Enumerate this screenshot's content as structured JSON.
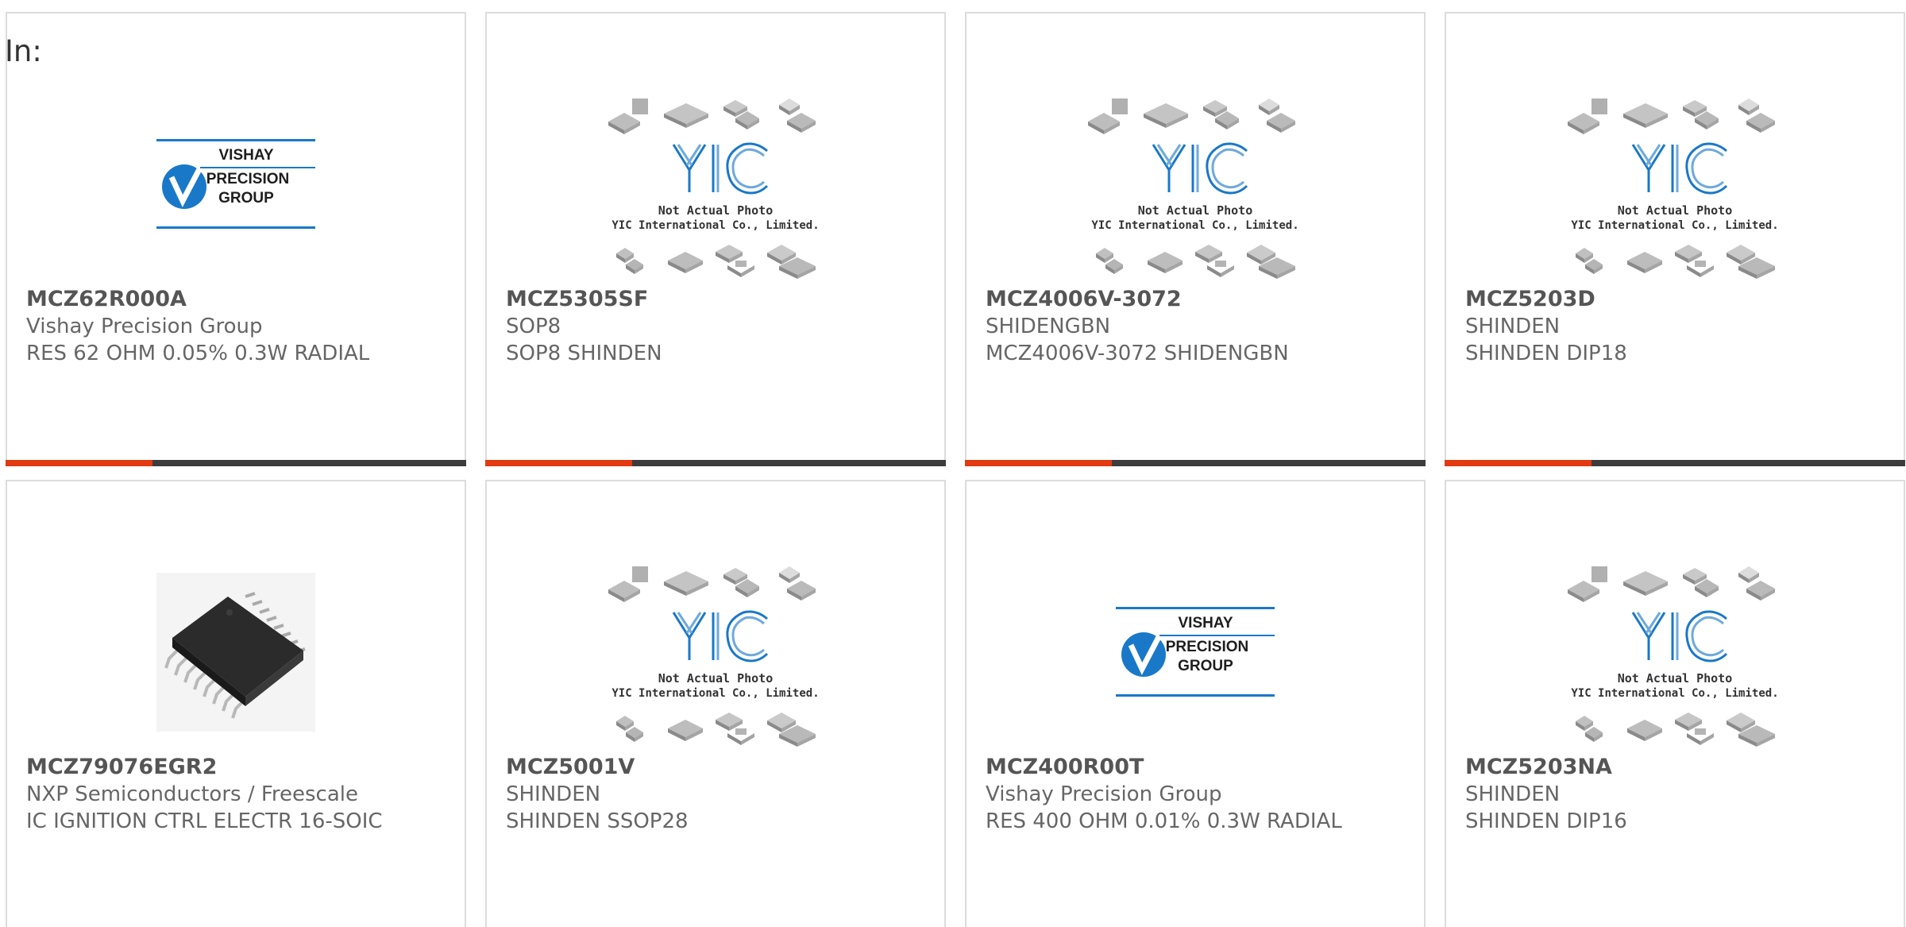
{
  "filter_label": "In:",
  "colors": {
    "accent": "#e23a11",
    "bar": "#3c3c3c",
    "border": "#dcdcdc",
    "vishay_blue": "#1a78c8"
  },
  "products": [
    {
      "part_number": "MCZ62R000A",
      "manufacturer": "Vishay Precision Group",
      "description": "RES 62 OHM 0.05% 0.3W RADIAL",
      "image": "vishay-logo",
      "logo_lines": [
        "VISHAY",
        "PRECISION",
        "GROUP"
      ]
    },
    {
      "part_number": "MCZ5305SF",
      "manufacturer": "SOP8",
      "description": "SOP8 SHINDEN",
      "image": "yic-placeholder",
      "placeholder_lines": [
        "Not Actual Photo",
        "YIC International Co., Limited."
      ]
    },
    {
      "part_number": "MCZ4006V-3072",
      "manufacturer": "SHIDENGBN",
      "description": "MCZ4006V-3072 SHIDENGBN",
      "image": "yic-placeholder",
      "placeholder_lines": [
        "Not Actual Photo",
        "YIC International Co., Limited."
      ]
    },
    {
      "part_number": "MCZ5203D",
      "manufacturer": "SHINDEN",
      "description": "SHINDEN DIP18",
      "image": "yic-placeholder",
      "placeholder_lines": [
        "Not Actual Photo",
        "YIC International Co., Limited."
      ]
    },
    {
      "part_number": "MCZ79076EGR2",
      "manufacturer": "NXP Semiconductors / Freescale",
      "description": "IC IGNITION CTRL ELECTR 16-SOIC",
      "image": "soic-chip-photo"
    },
    {
      "part_number": "MCZ5001V",
      "manufacturer": "SHINDEN",
      "description": "SHINDEN SSOP28",
      "image": "yic-placeholder",
      "placeholder_lines": [
        "Not Actual Photo",
        "YIC International Co., Limited."
      ]
    },
    {
      "part_number": "MCZ400R00T",
      "manufacturer": "Vishay Precision Group",
      "description": "RES 400 OHM 0.01% 0.3W RADIAL",
      "image": "vishay-logo",
      "logo_lines": [
        "VISHAY",
        "PRECISION",
        "GROUP"
      ]
    },
    {
      "part_number": "MCZ5203NA",
      "manufacturer": "SHINDEN",
      "description": "SHINDEN DIP16",
      "image": "yic-placeholder",
      "placeholder_lines": [
        "Not Actual Photo",
        "YIC International Co., Limited."
      ]
    }
  ]
}
